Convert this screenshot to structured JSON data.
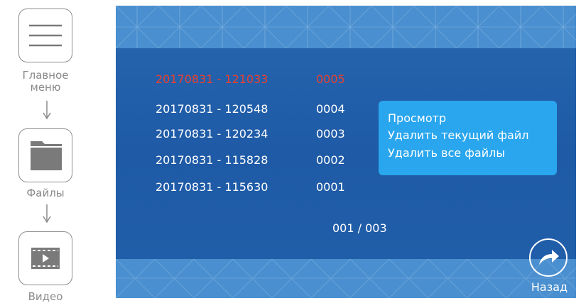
{
  "breadcrumb": {
    "main_menu_label": "Главное\nменю",
    "files_label": "Файлы",
    "video_label": "Видео"
  },
  "files": [
    {
      "name": "20170831 - 121033",
      "num": "0005",
      "selected": true
    },
    {
      "name": "20170831 - 120548",
      "num": "0004",
      "selected": false
    },
    {
      "name": "20170831 - 120234",
      "num": "0003",
      "selected": false
    },
    {
      "name": "20170831 - 115828",
      "num": "0002",
      "selected": false
    },
    {
      "name": "20170831 - 115630",
      "num": "0001",
      "selected": false
    }
  ],
  "context_menu": {
    "view": "Просмотр",
    "delete_current": "Удалить текущий файл",
    "delete_all": "Удалить все файлы"
  },
  "pager": "001 / 003",
  "back_label": "Назад",
  "colors": {
    "selected_text": "#e8412f",
    "panel": "#1e5aa6",
    "menu": "#2aa6ee",
    "band": "#4a8fcf"
  },
  "icons": {
    "main_menu": "hamburger-icon",
    "files": "folder-icon",
    "video": "film-icon",
    "back": "share-arrow-icon"
  }
}
